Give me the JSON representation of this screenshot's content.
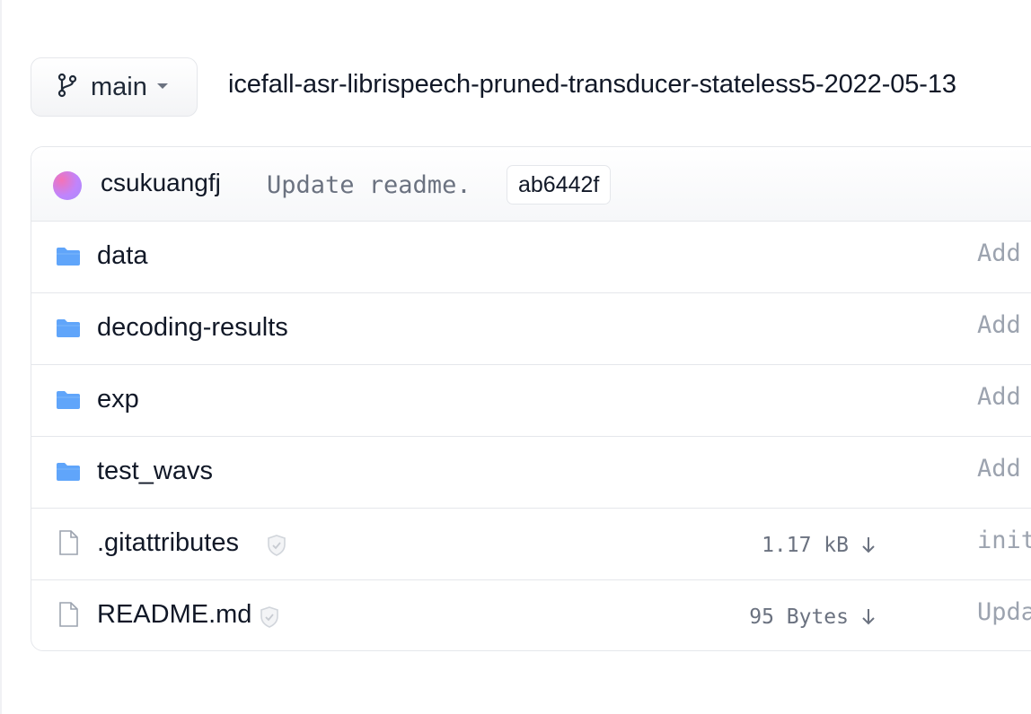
{
  "branch": {
    "label": "main"
  },
  "repo_path": "icefall-asr-librispeech-pruned-transducer-stateless5-2022-05-13",
  "last_commit": {
    "author": "csukuangfj",
    "message": "Update readme.",
    "hash": "ab6442f"
  },
  "files": [
    {
      "name": "data",
      "type": "folder",
      "size": "",
      "commit": "Add"
    },
    {
      "name": "decoding-results",
      "type": "folder",
      "size": "",
      "commit": "Add"
    },
    {
      "name": "exp",
      "type": "folder",
      "size": "",
      "commit": "Add"
    },
    {
      "name": "test_wavs",
      "type": "folder",
      "size": "",
      "commit": "Add"
    },
    {
      "name": ".gitattributes",
      "type": "file",
      "size": "1.17 kB",
      "commit": "init"
    },
    {
      "name": "README.md",
      "type": "file",
      "size": "95 Bytes",
      "commit": "Upda"
    }
  ],
  "colors": {
    "folder": "#60a5fa",
    "file_icon": "#9ca3af",
    "border": "#e5e7eb"
  },
  "icons": {
    "branch": "git-branch-icon",
    "caret": "chevron-down-icon",
    "folder": "folder-icon",
    "file": "file-icon",
    "safe": "shield-check-icon",
    "download": "download-arrow-icon"
  }
}
